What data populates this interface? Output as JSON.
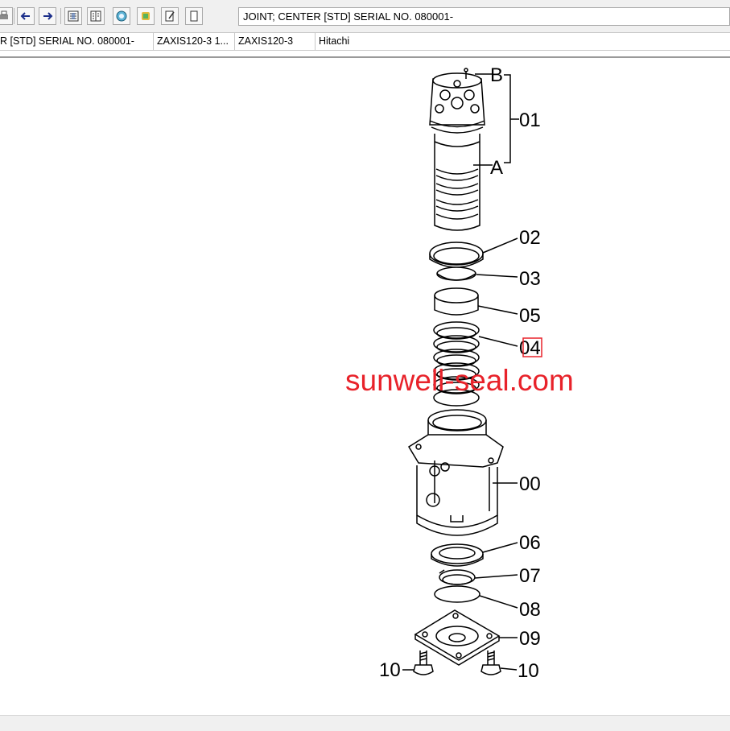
{
  "toolbar": {
    "buttons": [
      {
        "name": "print-icon"
      },
      {
        "name": "back-arrow-icon"
      },
      {
        "name": "forward-arrow-icon"
      },
      {
        "name": "parts-list-icon"
      },
      {
        "name": "illustration-icon"
      },
      {
        "name": "zoom-magnifier-icon"
      },
      {
        "name": "bookmark-icon"
      },
      {
        "name": "notes-icon"
      },
      {
        "name": "page-icon"
      }
    ],
    "title": "JOINT; CENTER [STD] SERIAL NO. 080001-"
  },
  "infobar": {
    "cells": [
      "R [STD] SERIAL NO. 080001-",
      "ZAXIS120-3 1...",
      "ZAXIS120-3",
      "Hitachi"
    ]
  },
  "diagram": {
    "labels": {
      "b": "B",
      "a": "A",
      "p01": "01",
      "p02": "02",
      "p03": "03",
      "p05": "05",
      "p04": "04",
      "p00": "00",
      "p06": "06",
      "p07": "07",
      "p08": "08",
      "p09": "09",
      "p10_left": "10",
      "p10_right": "10"
    },
    "highlighted_part": "04",
    "highlight_color": "#e8222a"
  },
  "watermark": "sunwell-seal.com"
}
